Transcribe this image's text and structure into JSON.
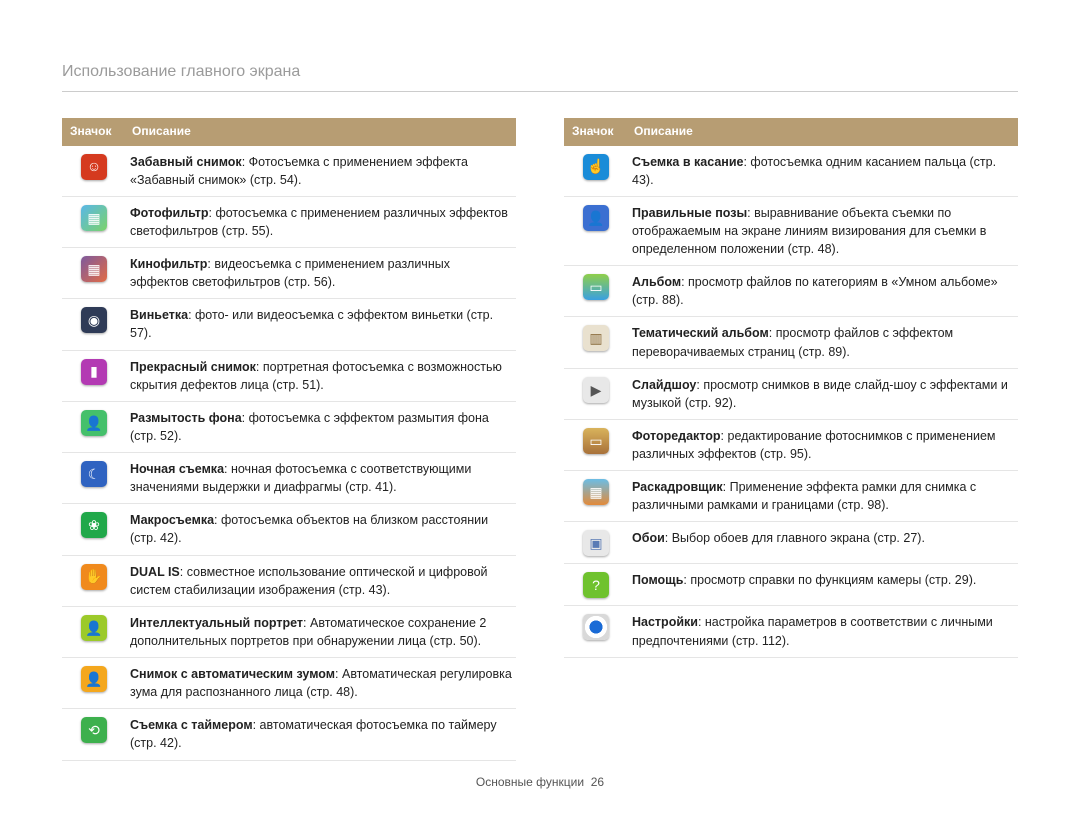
{
  "breadcrumb": "Использование главного экрана",
  "headers": {
    "icon": "Значок",
    "desc": "Описание"
  },
  "left": [
    {
      "icon": {
        "name": "funny-shot-icon",
        "bg": "#d53a1f",
        "glyph": "☺"
      },
      "title": "Забавный снимок",
      "body": ": Фотосъемка с применением эффекта «Забавный снимок» (стр. 54)."
    },
    {
      "icon": {
        "name": "photo-filter-icon",
        "bg": "linear-gradient(135deg,#5ab7e8,#7bd26a)",
        "glyph": "▦"
      },
      "title": "Фотофильтр",
      "body": ": фотосъемка с применением различных эффектов светофильтров (стр. 55)."
    },
    {
      "icon": {
        "name": "movie-filter-icon",
        "bg": "linear-gradient(135deg,#7d5a9e,#e26b45)",
        "glyph": "▦"
      },
      "title": "Кинофильтр",
      "body": ": видеосъемка с применением различных эффектов светофильтров (стр. 56)."
    },
    {
      "icon": {
        "name": "vignette-icon",
        "bg": "#2f3b57",
        "glyph": "◉"
      },
      "title": "Виньетка",
      "body": ": фото- или видеосъемка с эффектом виньетки (стр. 57)."
    },
    {
      "icon": {
        "name": "beauty-shot-icon",
        "bg": "#b33ab3",
        "glyph": "▮"
      },
      "title": "Прекрасный снимок",
      "body": ": портретная фотосъемка с возможностью скрытия дефектов лица (стр. 51)."
    },
    {
      "icon": {
        "name": "blur-background-icon",
        "bg": "#45c06b",
        "glyph": "👤"
      },
      "title": "Размытость фона",
      "body": ": фотосъемка с эффектом размытия фона (стр. 52)."
    },
    {
      "icon": {
        "name": "night-mode-icon",
        "bg": "#2f63c1",
        "glyph": "☾"
      },
      "title": "Ночная съемка",
      "body": ": ночная фотосъемка с соответствующими значениями выдержки и диафрагмы (стр. 41)."
    },
    {
      "icon": {
        "name": "macro-icon",
        "bg": "#21a84a",
        "glyph": "❀"
      },
      "title": "Макросъемка",
      "body": ": фотосъемка объектов на близком расстоянии (стр. 42)."
    },
    {
      "icon": {
        "name": "dual-is-icon",
        "bg": "#f08a1d",
        "glyph": "✋"
      },
      "title": "DUAL IS",
      "body": ": совместное использование оптической и цифровой систем стабилизации изображения (стр. 43)."
    },
    {
      "icon": {
        "name": "smart-portrait-icon",
        "bg": "#9cca2a",
        "glyph": "👤"
      },
      "title": "Интеллектуальный портрет",
      "body": ": Автоматическое сохранение 2 дополнительных портретов при обнаружении лица (стр. 50)."
    },
    {
      "icon": {
        "name": "auto-zoom-icon",
        "bg": "#f4a71d",
        "glyph": "👤"
      },
      "title": "Снимок с автоматическим зумом",
      "body": ": Автоматическая регулировка зума для распознанного лица (стр. 48)."
    },
    {
      "icon": {
        "name": "timer-shot-icon",
        "bg": "#3db04d",
        "glyph": "⟲"
      },
      "title": "Съемка с таймером",
      "body": ": автоматическая фотосъемка по таймеру (стр. 42)."
    }
  ],
  "right": [
    {
      "icon": {
        "name": "touch-shot-icon",
        "bg": "#1a8cd8",
        "glyph": "☝"
      },
      "title": "Съемка в касание",
      "body": ": фотосъемка одним касанием пальца (стр. 43)."
    },
    {
      "icon": {
        "name": "pose-guide-icon",
        "bg": "#3b6fd1",
        "glyph": "👤"
      },
      "title": "Правильные позы",
      "body": ": выравнивание объекта съемки по отображаемым на экране линиям визирования для съемки в определенном положении (стр. 48)."
    },
    {
      "icon": {
        "name": "album-icon",
        "bg": "linear-gradient(#8fcf4a,#3aa0e0)",
        "glyph": "▭"
      },
      "title": "Альбом",
      "body": ": просмотр файлов по категориям в «Умном альбоме» (стр. 88)."
    },
    {
      "icon": {
        "name": "theme-album-icon",
        "bg": "#e9e1cf",
        "glyph": "▥",
        "fg": "#8a6b3c"
      },
      "title": "Тематический альбом",
      "body": ": просмотр файлов с эффектом переворачиваемых страниц (стр. 89)."
    },
    {
      "icon": {
        "name": "slideshow-icon",
        "bg": "#e8e8e8",
        "glyph": "▶",
        "fg": "#555"
      },
      "title": "Слайдшоу",
      "body": ": просмотр снимков в виде слайд-шоу с эффектами и музыкой (стр. 92)."
    },
    {
      "icon": {
        "name": "photo-editor-icon",
        "bg": "linear-gradient(#d9b35c,#a8713a)",
        "glyph": "▭"
      },
      "title": "Фоторедактор",
      "body": ": редактирование фотоснимков с применением различных эффектов (стр. 95)."
    },
    {
      "icon": {
        "name": "storyboard-icon",
        "bg": "linear-gradient(#6bbde5,#e28a3a)",
        "glyph": "▦"
      },
      "title": "Раскадровщик",
      "body": ": Применение эффекта рамки для снимка с различными рамками и границами (стр. 98)."
    },
    {
      "icon": {
        "name": "wallpaper-icon",
        "bg": "#e8e8e8",
        "glyph": "▣",
        "fg": "#5a7bb5"
      },
      "title": "Обои",
      "body": ": Выбор обоев для главного экрана (стр. 27)."
    },
    {
      "icon": {
        "name": "help-icon",
        "bg": "#6fc22e",
        "glyph": "?",
        "fg": "#fff"
      },
      "title": "Помощь",
      "body": ": просмотр справки по функциям камеры (стр. 29)."
    },
    {
      "icon": {
        "name": "settings-icon",
        "bg": "radial-gradient(circle,#1a6bd6 35%,#fff 36%,#fff 60%,#d9d9d9 61%)",
        "glyph": ""
      },
      "title": "Настройки",
      "body": ": настройка параметров в соответствии с личными предпочтениями (стр. 112)."
    }
  ],
  "footer": {
    "section": "Основные функции",
    "page": "26"
  }
}
